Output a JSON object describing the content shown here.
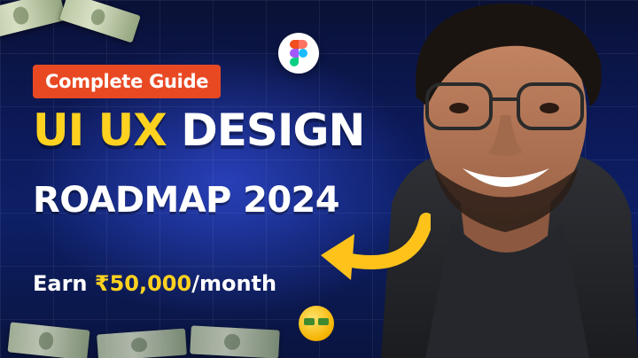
{
  "thumbnail": {
    "badge_label": "Complete Guide",
    "title_part1": "UI UX",
    "title_part2": "DESIGN",
    "subtitle": "ROADMAP 2024",
    "earn_prefix": "Earn",
    "earn_amount": "₹50,000",
    "earn_suffix": "/month"
  },
  "colors": {
    "accent_yellow": "#ffd21f",
    "badge_orange": "#e84923",
    "background_blue": "#0d1f66"
  },
  "icons": {
    "logo": "figma-logo",
    "arrow": "curved-arrow-icon",
    "emoji": "money-face-emoji"
  }
}
